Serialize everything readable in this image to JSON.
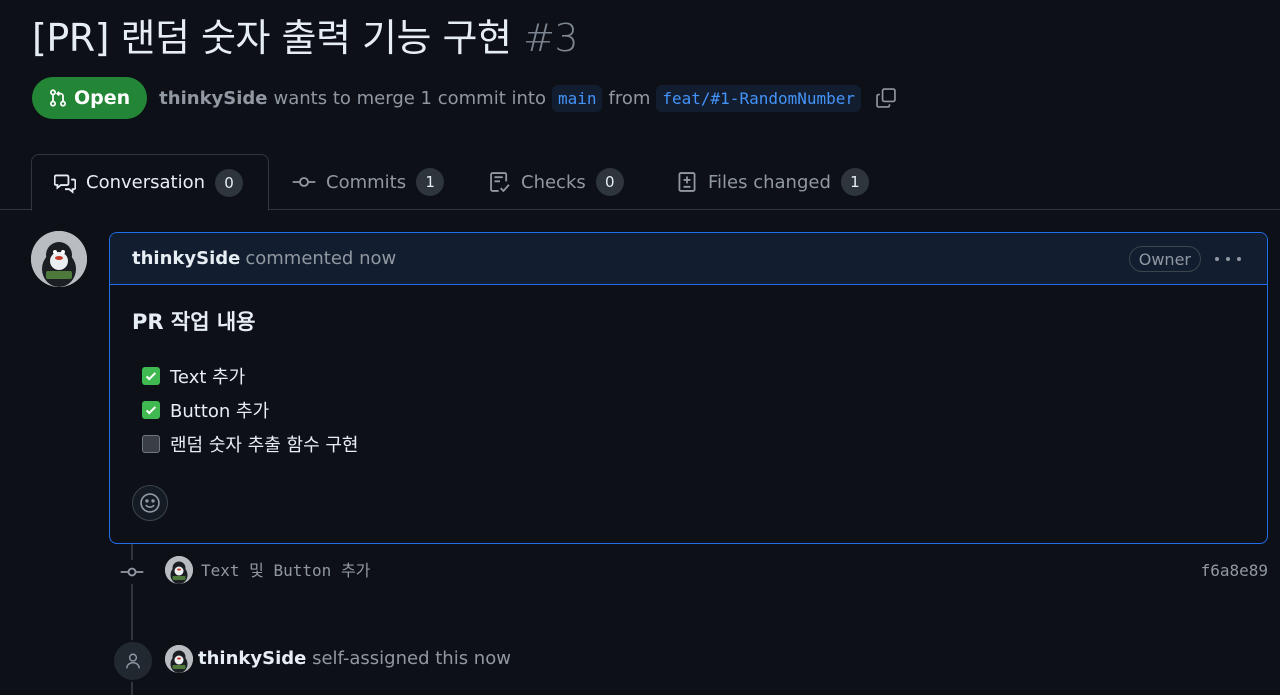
{
  "pr": {
    "title": "[PR] 랜덤 숫자 출력 기능 구현",
    "number": "#3",
    "state": "Open",
    "author": "thinkySide",
    "merge_text_1": "wants to merge 1 commit into",
    "base_branch": "main",
    "merge_text_2": "from",
    "head_branch": "feat/#1-RandomNumber",
    "state_color": "#238636"
  },
  "tabs": [
    {
      "label": "Conversation",
      "count": "0",
      "icon": "comment-discussion-icon"
    },
    {
      "label": "Commits",
      "count": "1",
      "icon": "git-commit-icon"
    },
    {
      "label": "Checks",
      "count": "0",
      "icon": "checklist-icon"
    },
    {
      "label": "Files changed",
      "count": "1",
      "icon": "file-diff-icon"
    }
  ],
  "comment": {
    "author": "thinkySide",
    "meta": "commented now",
    "role_badge": "Owner",
    "heading": "PR 작업 내용",
    "tasks": [
      {
        "label": "Text 추가",
        "checked": true
      },
      {
        "label": "Button 추가",
        "checked": true
      },
      {
        "label": "랜덤 숫자 추출 함수 구현",
        "checked": false
      }
    ]
  },
  "timeline": {
    "commit": {
      "message": "Text 및 Button 추가",
      "sha": "f6a8e89"
    },
    "assign": {
      "user": "thinkySide",
      "action": "self-assigned this now"
    }
  },
  "colors": {
    "accent": "#1f6feb",
    "link": "#4493f8",
    "success": "#3fb950"
  }
}
